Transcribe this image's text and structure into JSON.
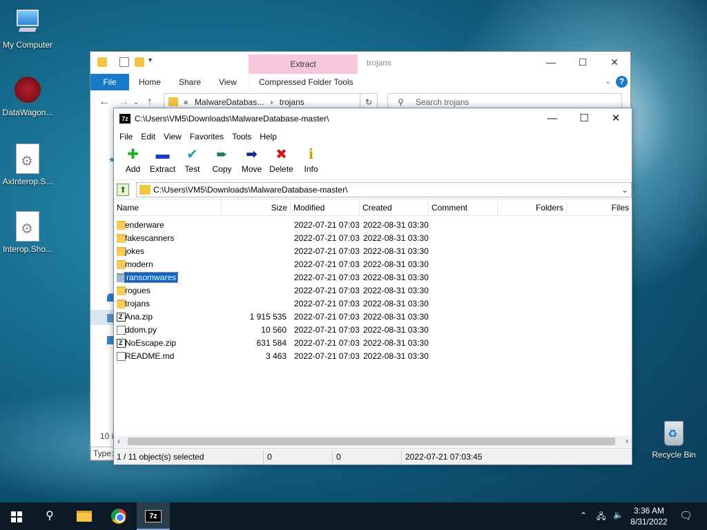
{
  "desktop": {
    "icons": [
      {
        "label": "My Computer"
      },
      {
        "label": "DataWagon..."
      },
      {
        "label": "AxInterop.S..."
      },
      {
        "label": "Interop.Sho..."
      },
      {
        "label": "Recycle Bin"
      }
    ]
  },
  "explorer": {
    "context_tab": "Extract",
    "title": "trojans",
    "tabs": [
      "File",
      "Home",
      "Share",
      "View",
      "Compressed Folder Tools"
    ],
    "address": {
      "chevron": "«",
      "segment1": "MalwareDatabas...",
      "separator": "›",
      "segment2": "trojans"
    },
    "search_placeholder": "Search trojans",
    "status_fragment": "10 i",
    "type_fragment": "Type:"
  },
  "zip": {
    "title": "C:\\Users\\VM5\\Downloads\\MalwareDatabase-master\\",
    "menu": [
      "File",
      "Edit",
      "View",
      "Favorites",
      "Tools",
      "Help"
    ],
    "toolbar": [
      {
        "label": "Add",
        "icon": "plus-icon",
        "glyph": "✚",
        "color": "#1db11d"
      },
      {
        "label": "Extract",
        "icon": "minus-icon",
        "glyph": "▬",
        "color": "#1d3fbf"
      },
      {
        "label": "Test",
        "icon": "check-icon",
        "glyph": "✔",
        "color": "#19a2b0"
      },
      {
        "label": "Copy",
        "icon": "copy-arrow-icon",
        "glyph": "➨",
        "color": "#1b7c6a"
      },
      {
        "label": "Move",
        "icon": "move-arrow-icon",
        "glyph": "➡",
        "color": "#1a2c8c"
      },
      {
        "label": "Delete",
        "icon": "delete-x-icon",
        "glyph": "✖",
        "color": "#d11a1a"
      },
      {
        "label": "Info",
        "icon": "info-icon",
        "glyph": "ℹ",
        "color": "#caa400"
      }
    ],
    "path": "C:\\Users\\VM5\\Downloads\\MalwareDatabase-master\\",
    "columns": {
      "name": "Name",
      "size": "Size",
      "modified": "Modified",
      "created": "Created",
      "comment": "Comment",
      "folders": "Folders",
      "files": "Files"
    },
    "rows": [
      {
        "name": "enderware",
        "type": "folder",
        "size": "",
        "modified": "2022-07-21 07:03",
        "created": "2022-08-31 03:30"
      },
      {
        "name": "fakescanners",
        "type": "folder",
        "size": "",
        "modified": "2022-07-21 07:03",
        "created": "2022-08-31 03:30"
      },
      {
        "name": "jokes",
        "type": "folder",
        "size": "",
        "modified": "2022-07-21 07:03",
        "created": "2022-08-31 03:30"
      },
      {
        "name": "modern",
        "type": "folder",
        "size": "",
        "modified": "2022-07-21 07:03",
        "created": "2022-08-31 03:30"
      },
      {
        "name": "ransomwares",
        "type": "folder",
        "size": "",
        "modified": "2022-07-21 07:03",
        "created": "2022-08-31 03:30",
        "selected": true
      },
      {
        "name": "rogues",
        "type": "folder",
        "size": "",
        "modified": "2022-07-21 07:03",
        "created": "2022-08-31 03:30"
      },
      {
        "name": "trojans",
        "type": "folder",
        "size": "",
        "modified": "2022-07-21 07:03",
        "created": "2022-08-31 03:30"
      },
      {
        "name": "Ana.zip",
        "type": "zip",
        "size": "1 915 535",
        "modified": "2022-07-21 07:03",
        "created": "2022-08-31 03:30"
      },
      {
        "name": "ddom.py",
        "type": "file",
        "size": "10 560",
        "modified": "2022-07-21 07:03",
        "created": "2022-08-31 03:30"
      },
      {
        "name": "NoEscape.zip",
        "type": "zip",
        "size": "631 584",
        "modified": "2022-07-21 07:03",
        "created": "2022-08-31 03:30"
      },
      {
        "name": "README.md",
        "type": "file",
        "size": "3 463",
        "modified": "2022-07-21 07:03",
        "created": "2022-08-31 03:30"
      }
    ],
    "status": {
      "selection": "1 / 11 object(s) selected",
      "size1": "0",
      "size2": "0",
      "datetime": "2022-07-21 07:03:45"
    }
  },
  "taskbar": {
    "clock_time": "3:36 AM",
    "clock_date": "8/31/2022",
    "zip_label": "7z"
  }
}
